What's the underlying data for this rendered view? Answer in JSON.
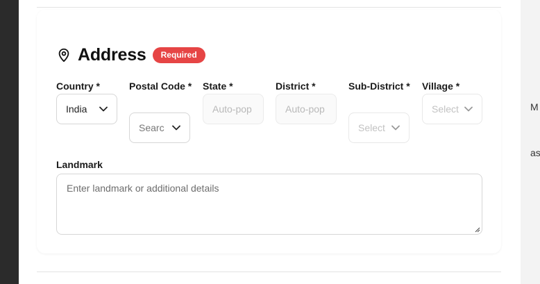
{
  "section": {
    "title": "Address",
    "badge": "Required",
    "icon": "map-pin-icon"
  },
  "fields": [
    {
      "label": "Country *",
      "value": "India",
      "kind": "select"
    },
    {
      "label": "Postal Code *",
      "value": "Searc",
      "kind": "select"
    },
    {
      "label": "State *",
      "value": "Auto-pop",
      "kind": "readonly"
    },
    {
      "label": "District *",
      "value": "Auto-pop",
      "kind": "readonly"
    },
    {
      "label": "Sub-District *",
      "value": "Select",
      "kind": "select"
    },
    {
      "label": "Village *",
      "value": "Select",
      "kind": "select"
    }
  ],
  "landmark": {
    "label": "Landmark",
    "placeholder": "Enter landmark or additional details"
  },
  "background_fragments": [
    "M",
    "as"
  ],
  "colors": {
    "badge": "#e64545",
    "border": "#d6d6d6",
    "backdrop": "#2b2b2b"
  }
}
